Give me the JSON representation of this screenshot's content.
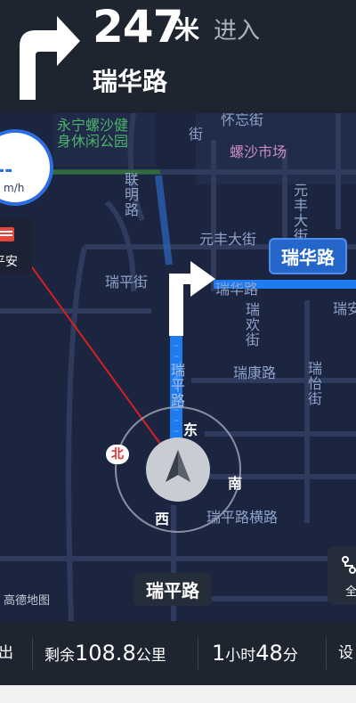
{
  "guidance": {
    "turn": "turn-right",
    "distance": "247",
    "unit": "米",
    "action": "进入",
    "next_road": "瑞华路"
  },
  "map": {
    "speed_limit_bar": "--",
    "speed_unit": "m/h",
    "safety_label": "平安",
    "labels": {
      "park": "永宁螺沙健身休闲公园",
      "park_line1": "永宁螺沙健",
      "park_line2": "身休闲公园",
      "market": "螺沙市场",
      "lianming": "联明路",
      "yuanfeng_street_v": "元丰大街",
      "yuanfeng_street_h": "元丰大街",
      "ruiping_left": "瑞平街",
      "ruihua_road": "瑞华路",
      "ruian": "瑞安",
      "ruihuan": "瑞欢街",
      "ruikang": "瑞康路",
      "ruiyi": "瑞怡街",
      "ruiping_road_v": "瑞平路",
      "ruiping_heng": "瑞平路横路",
      "top_partial": "怀忘街",
      "top_partial2": "街"
    },
    "next_road_flag": "瑞华路",
    "compass": {
      "north": "北",
      "east": "东",
      "south": "南",
      "west": "西"
    },
    "current_road": "瑞平路",
    "logo": "高德地图",
    "side_button_label": "全",
    "colors": {
      "route": "#1e7cf0",
      "map_bg": "#1b2540",
      "road": "#2d3a5a"
    }
  },
  "bottom": {
    "exit_label": "出",
    "remain_prefix": "剩余",
    "remain_value": "108.8",
    "remain_unit": "公里",
    "time_hours": "1",
    "time_hours_unit": "小时",
    "time_minutes": "48",
    "time_minutes_unit": "分",
    "settings_label": "设"
  }
}
